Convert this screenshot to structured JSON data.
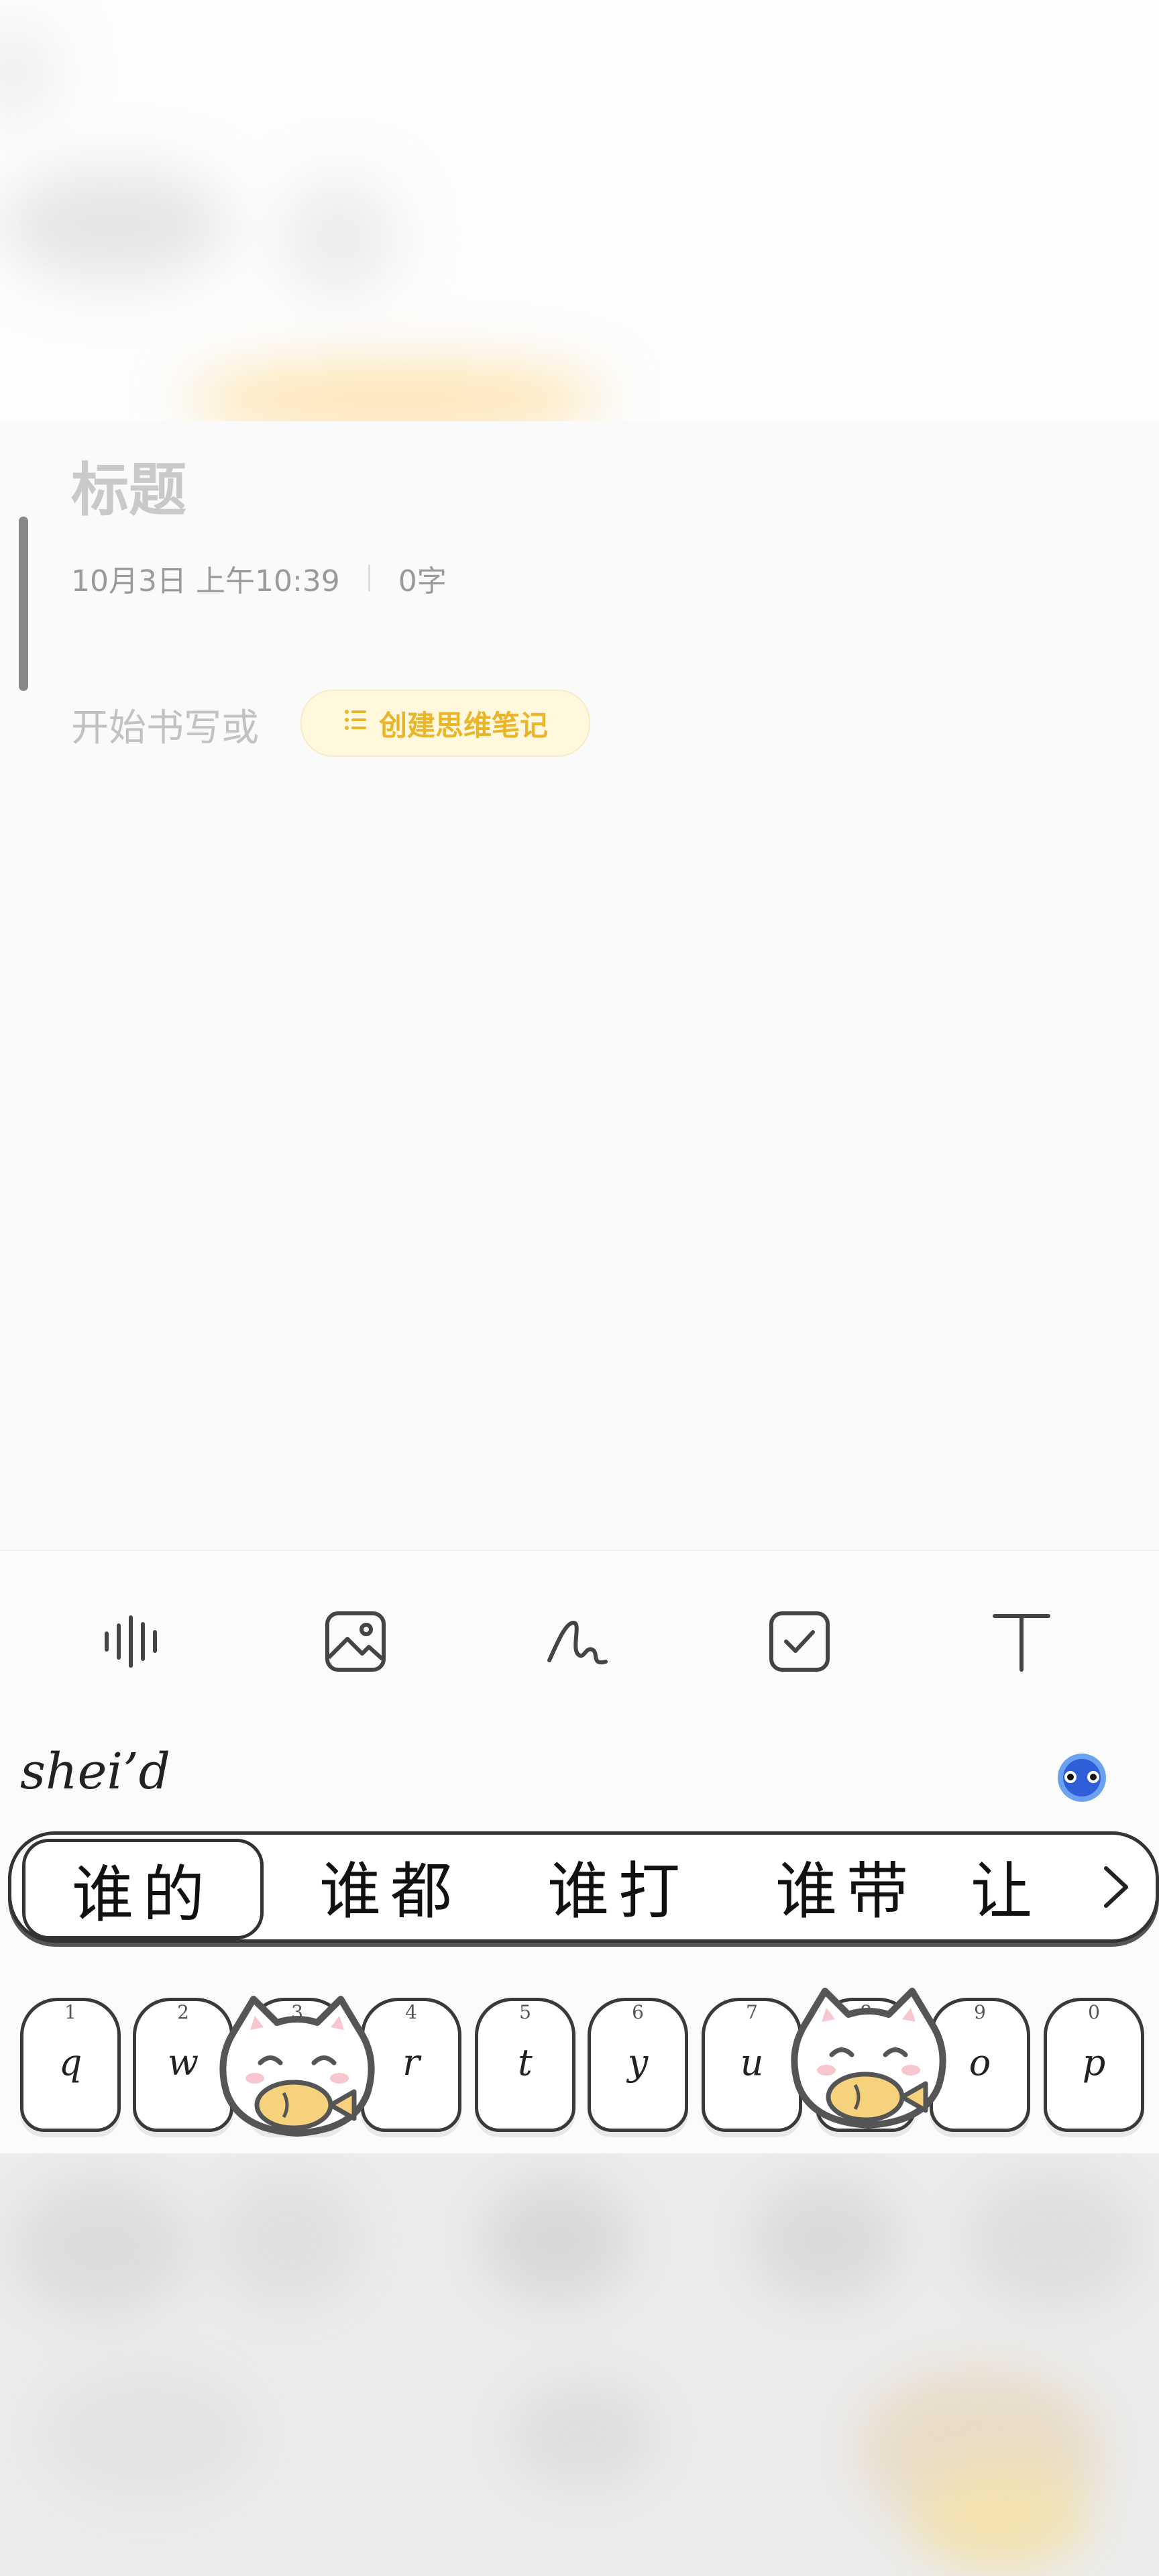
{
  "note": {
    "title_placeholder": "标题",
    "date": "10月3日 上午10:39",
    "word_count": "0字",
    "body_placeholder": "开始书写或",
    "mind_note_button": "创建思维笔记"
  },
  "toolbar": {
    "items": [
      "voice-icon",
      "image-icon",
      "handwriting-icon",
      "checkbox-icon",
      "text-format-icon"
    ]
  },
  "ime": {
    "composing_text": "shei’d",
    "candidates": [
      "谁的",
      "谁都",
      "谁打",
      "谁带",
      "让"
    ],
    "keys": [
      {
        "num": "1",
        "letter": "q"
      },
      {
        "num": "2",
        "letter": "w"
      },
      {
        "num": "3",
        "letter": "e"
      },
      {
        "num": "4",
        "letter": "r"
      },
      {
        "num": "5",
        "letter": "t"
      },
      {
        "num": "6",
        "letter": "y"
      },
      {
        "num": "7",
        "letter": "u"
      },
      {
        "num": "8",
        "letter": "i"
      },
      {
        "num": "9",
        "letter": "o"
      },
      {
        "num": "0",
        "letter": "p"
      }
    ]
  },
  "colors": {
    "accent": "#e9b52a",
    "mind_button_bg": "#fff8dc"
  }
}
